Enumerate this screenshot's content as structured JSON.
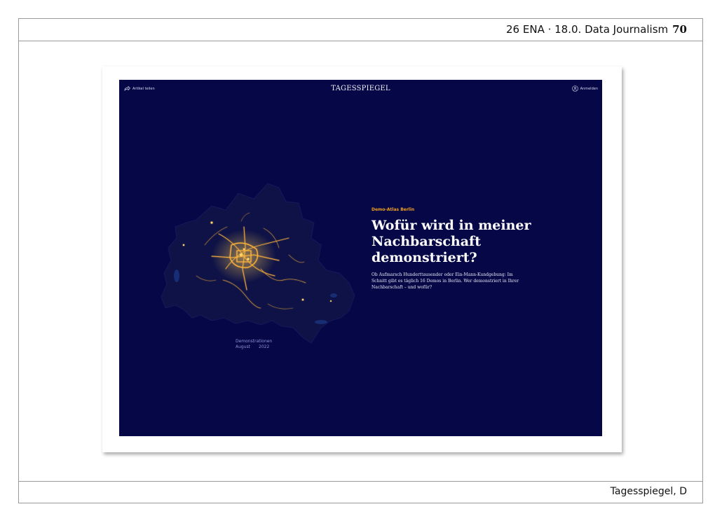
{
  "slide": {
    "header": "26 ENA · 18.0. Data Journalism",
    "page_number": "70",
    "footer": "Tagesspiegel, D"
  },
  "screenshot": {
    "share_label": "Artikel teilen",
    "logo": "TAGESSPIEGEL",
    "login_label": "Anmelden",
    "kicker": "Demo-Atlas Berlin",
    "headline": "Wofür wird in meiner Nachbarschaft demonstriert?",
    "lead": "Ob Aufmarsch Hunderttausender oder Ein-Mann-Kundgebung: Im Schnitt gibt es täglich 16 Demos in Berlin. Wer demonstriert in Ihrer Nachbarschaft – und wofür?",
    "map_caption_line1": "Demonstrationen",
    "map_caption_month": "August",
    "map_caption_year": "2022",
    "colors": {
      "background": "#050747",
      "map_fill": "#0e1246",
      "accent": "#f2a11d",
      "route_glow": "#ffb43a"
    },
    "icons": [
      "share-arrow-icon",
      "user-circle-icon"
    ]
  }
}
